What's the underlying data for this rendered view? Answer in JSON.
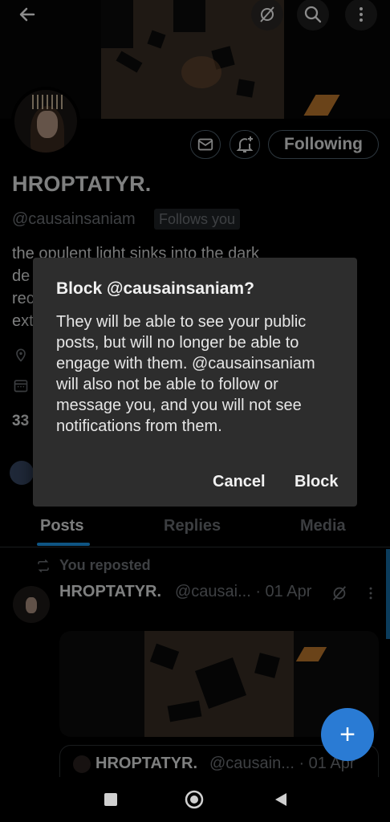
{
  "header": {
    "back_icon": "arrow-left-icon",
    "icons": [
      "no-signal-icon",
      "search-icon",
      "more-vertical-icon"
    ]
  },
  "profile": {
    "name": "HROPTATYR.",
    "handle": "@causainsaniam",
    "follows_badge": "Follows you",
    "following_label": "Following",
    "bio_lines": [
      "the opulent light sinks into the dark",
      "de",
      "rec",
      "ext"
    ],
    "stat_partial": "33"
  },
  "dialog": {
    "title": "Block @causainsaniam?",
    "message": "They will be able to see your public posts, but will no longer be able to engage with them. @causainsaniam will also not be able to follow or message you, and you will not see notifications from them.",
    "cancel_label": "Cancel",
    "block_label": "Block"
  },
  "tabs": [
    {
      "label": "Posts",
      "active": true
    },
    {
      "label": "Replies",
      "active": false
    },
    {
      "label": "Media",
      "active": false
    }
  ],
  "post": {
    "repost_label": "You reposted",
    "name": "HROPTATYR.",
    "handle_date": "@causai... · 01 Apr",
    "quote_name": "HROPTATYR.",
    "quote_handle_date": "@causain... · 01 Apr"
  },
  "fab_label": "+",
  "colors": {
    "accent": "#1d9bf0",
    "dialog_bg": "#2d2d2d",
    "muted": "#71767b"
  }
}
